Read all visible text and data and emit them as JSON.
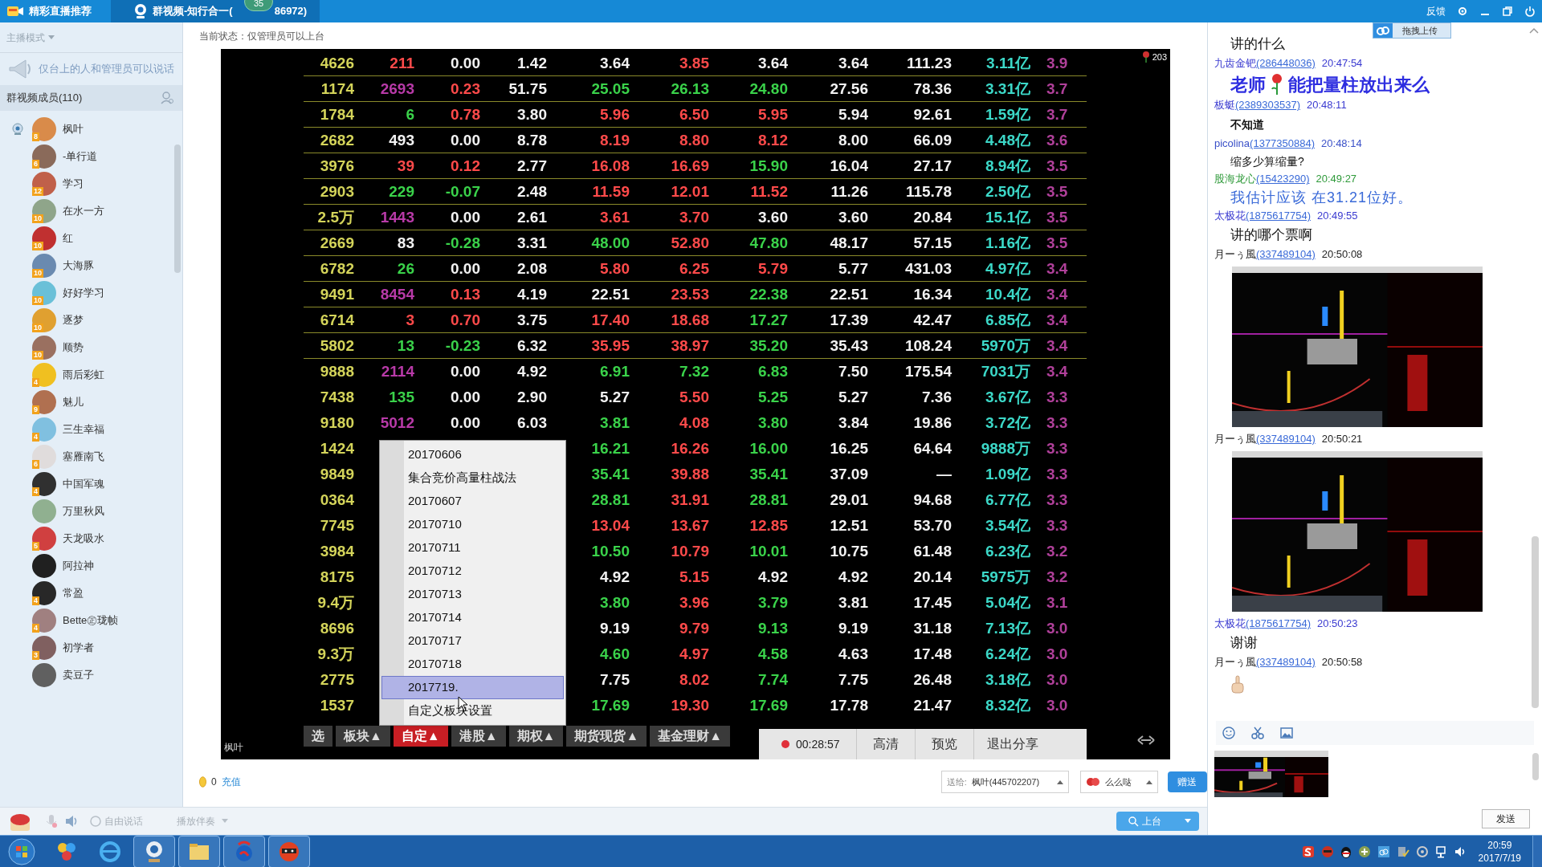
{
  "top_bar": {
    "tabs": [
      {
        "label": "精彩直播推荐",
        "selected": false
      },
      {
        "label": "群视频-知行合一(",
        "label_end": "86972)",
        "badge": "35",
        "selected": true
      }
    ],
    "feedback": "反馈"
  },
  "sidebar": {
    "mode": "主播模式",
    "notice": "仅台上的人和管理员可以说话",
    "members_title": "群视频成员(110)",
    "members": [
      {
        "name": "枫叶",
        "level": "8",
        "on_stage": true
      },
      {
        "name": "-单行道",
        "level": "6",
        "on_stage": false
      },
      {
        "name": "学习",
        "level": "12",
        "on_stage": false
      },
      {
        "name": "在水一方",
        "level": "10",
        "on_stage": false
      },
      {
        "name": "红",
        "level": "10",
        "on_stage": false
      },
      {
        "name": "大海豚",
        "level": "10",
        "on_stage": false
      },
      {
        "name": "好好学习",
        "level": "10",
        "on_stage": false
      },
      {
        "name": "逐梦",
        "level": "10",
        "on_stage": false
      },
      {
        "name": "顺势",
        "level": "10",
        "on_stage": false
      },
      {
        "name": "雨后彩虹",
        "level": "4",
        "on_stage": false
      },
      {
        "name": "魅儿",
        "level": "9",
        "on_stage": false
      },
      {
        "name": "三生幸福",
        "level": "4",
        "on_stage": false
      },
      {
        "name": "塞雁南飞",
        "level": "6",
        "on_stage": false
      },
      {
        "name": "中国军魂",
        "level": "4",
        "on_stage": false
      },
      {
        "name": "万里秋风",
        "on_stage": false
      },
      {
        "name": "天龙吸水",
        "level": "5",
        "on_stage": false
      },
      {
        "name": "阿拉神",
        "on_stage": false
      },
      {
        "name": "常盈",
        "level": "4",
        "on_stage": false
      },
      {
        "name": "Bette㊣珑帧",
        "level": "4",
        "on_stage": false
      },
      {
        "name": "初学者",
        "level": "3",
        "on_stage": false
      },
      {
        "name": "卖豆子",
        "on_stage": false
      }
    ]
  },
  "center": {
    "status": "当前状态：仅管理员可以上台",
    "video": {
      "presenter": "枫叶",
      "viewers": "203",
      "table": {
        "rows": [
          {
            "ruled": true,
            "cells": [
              {
                "text": "4626",
                "color": "#d4d45a"
              },
              {
                "text": "211",
                "color": "#ff4a4a"
              },
              {
                "text": "0.00",
                "color": "#f2f2f2"
              },
              {
                "text": "1.42",
                "color": "#f2f2f2"
              },
              {
                "text": "3.64",
                "color": "#f2f2f2"
              },
              {
                "text": "3.85",
                "color": "#ff4a4a"
              },
              {
                "text": "3.64",
                "color": "#f2f2f2"
              },
              {
                "text": "3.64",
                "color": "#f2f2f2"
              },
              {
                "text": "111.23",
                "color": "#f2f2f2"
              },
              {
                "text": "3.11亿",
                "color": "#3cd8c8"
              },
              {
                "text": "3.9",
                "color": "#b0409a"
              }
            ]
          },
          {
            "ruled": true,
            "cells": [
              {
                "text": "1174",
                "color": "#d4d45a"
              },
              {
                "text": "2693",
                "color": "#b83aa8"
              },
              {
                "text": "0.23",
                "color": "#ff4a4a"
              },
              {
                "text": "51.75",
                "color": "#f2f2f2"
              },
              {
                "text": "25.05",
                "color": "#3ad24a"
              },
              {
                "text": "26.13",
                "color": "#3ad24a"
              },
              {
                "text": "24.80",
                "color": "#3ad24a"
              },
              {
                "text": "27.56",
                "color": "#f2f2f2"
              },
              {
                "text": "78.36",
                "color": "#f2f2f2"
              },
              {
                "text": "3.31亿",
                "color": "#3cd8c8"
              },
              {
                "text": "3.7",
                "color": "#b0409a"
              }
            ]
          },
          {
            "ruled": true,
            "cells": [
              {
                "text": "1784",
                "color": "#d4d45a"
              },
              {
                "text": "6",
                "color": "#3ad24a"
              },
              {
                "text": "0.78",
                "color": "#ff4a4a"
              },
              {
                "text": "3.80",
                "color": "#f2f2f2"
              },
              {
                "text": "5.96",
                "color": "#ff4a4a"
              },
              {
                "text": "6.50",
                "color": "#ff4a4a"
              },
              {
                "text": "5.95",
                "color": "#ff4a4a"
              },
              {
                "text": "5.94",
                "color": "#f2f2f2"
              },
              {
                "text": "92.61",
                "color": "#f2f2f2"
              },
              {
                "text": "1.59亿",
                "color": "#3cd8c8"
              },
              {
                "text": "3.7",
                "color": "#b0409a"
              }
            ]
          },
          {
            "ruled": true,
            "cells": [
              {
                "text": "2682",
                "color": "#d4d45a"
              },
              {
                "text": "493",
                "color": "#f2f2f2"
              },
              {
                "text": "0.00",
                "color": "#f2f2f2"
              },
              {
                "text": "8.78",
                "color": "#f2f2f2"
              },
              {
                "text": "8.19",
                "color": "#ff4a4a"
              },
              {
                "text": "8.80",
                "color": "#ff4a4a"
              },
              {
                "text": "8.12",
                "color": "#ff4a4a"
              },
              {
                "text": "8.00",
                "color": "#f2f2f2"
              },
              {
                "text": "66.09",
                "color": "#f2f2f2"
              },
              {
                "text": "4.48亿",
                "color": "#3cd8c8"
              },
              {
                "text": "3.6",
                "color": "#b0409a"
              }
            ]
          },
          {
            "ruled": true,
            "cells": [
              {
                "text": "3976",
                "color": "#d4d45a"
              },
              {
                "text": "39",
                "color": "#ff4a4a"
              },
              {
                "text": "0.12",
                "color": "#ff4a4a"
              },
              {
                "text": "2.77",
                "color": "#f2f2f2"
              },
              {
                "text": "16.08",
                "color": "#ff4a4a"
              },
              {
                "text": "16.69",
                "color": "#ff4a4a"
              },
              {
                "text": "15.90",
                "color": "#3ad24a"
              },
              {
                "text": "16.04",
                "color": "#f2f2f2"
              },
              {
                "text": "27.17",
                "color": "#f2f2f2"
              },
              {
                "text": "8.94亿",
                "color": "#3cd8c8"
              },
              {
                "text": "3.5",
                "color": "#b0409a"
              }
            ]
          },
          {
            "ruled": true,
            "cells": [
              {
                "text": "2903",
                "color": "#d4d45a"
              },
              {
                "text": "229",
                "color": "#3ad24a"
              },
              {
                "text": "-0.07",
                "color": "#3ad24a"
              },
              {
                "text": "2.48",
                "color": "#f2f2f2"
              },
              {
                "text": "11.59",
                "color": "#ff4a4a"
              },
              {
                "text": "12.01",
                "color": "#ff4a4a"
              },
              {
                "text": "11.52",
                "color": "#ff4a4a"
              },
              {
                "text": "11.26",
                "color": "#f2f2f2"
              },
              {
                "text": "115.78",
                "color": "#f2f2f2"
              },
              {
                "text": "2.50亿",
                "color": "#3cd8c8"
              },
              {
                "text": "3.5",
                "color": "#b0409a"
              }
            ]
          },
          {
            "ruled": true,
            "cells": [
              {
                "text": "2.5万",
                "color": "#d4d45a"
              },
              {
                "text": "1443",
                "color": "#b83aa8"
              },
              {
                "text": "0.00",
                "color": "#f2f2f2"
              },
              {
                "text": "2.61",
                "color": "#f2f2f2"
              },
              {
                "text": "3.61",
                "color": "#ff4a4a"
              },
              {
                "text": "3.70",
                "color": "#ff4a4a"
              },
              {
                "text": "3.60",
                "color": "#f2f2f2"
              },
              {
                "text": "3.60",
                "color": "#f2f2f2"
              },
              {
                "text": "20.84",
                "color": "#f2f2f2"
              },
              {
                "text": "15.1亿",
                "color": "#3cd8c8"
              },
              {
                "text": "3.5",
                "color": "#b0409a"
              }
            ]
          },
          {
            "ruled": true,
            "cells": [
              {
                "text": "2669",
                "color": "#d4d45a"
              },
              {
                "text": "83",
                "color": "#f2f2f2"
              },
              {
                "text": "-0.28",
                "color": "#3ad24a"
              },
              {
                "text": "3.31",
                "color": "#f2f2f2"
              },
              {
                "text": "48.00",
                "color": "#3ad24a"
              },
              {
                "text": "52.80",
                "color": "#ff4a4a"
              },
              {
                "text": "47.80",
                "color": "#3ad24a"
              },
              {
                "text": "48.17",
                "color": "#f2f2f2"
              },
              {
                "text": "57.15",
                "color": "#f2f2f2"
              },
              {
                "text": "1.16亿",
                "color": "#3cd8c8"
              },
              {
                "text": "3.5",
                "color": "#b0409a"
              }
            ]
          },
          {
            "ruled": true,
            "cells": [
              {
                "text": "6782",
                "color": "#d4d45a"
              },
              {
                "text": "26",
                "color": "#3ad24a"
              },
              {
                "text": "0.00",
                "color": "#f2f2f2"
              },
              {
                "text": "2.08",
                "color": "#f2f2f2"
              },
              {
                "text": "5.80",
                "color": "#ff4a4a"
              },
              {
                "text": "6.25",
                "color": "#ff4a4a"
              },
              {
                "text": "5.79",
                "color": "#ff4a4a"
              },
              {
                "text": "5.77",
                "color": "#f2f2f2"
              },
              {
                "text": "431.03",
                "color": "#f2f2f2"
              },
              {
                "text": "4.97亿",
                "color": "#3cd8c8"
              },
              {
                "text": "3.4",
                "color": "#b0409a"
              }
            ]
          },
          {
            "ruled": true,
            "cells": [
              {
                "text": "9491",
                "color": "#d4d45a"
              },
              {
                "text": "8454",
                "color": "#b83aa8"
              },
              {
                "text": "0.13",
                "color": "#ff4a4a"
              },
              {
                "text": "4.19",
                "color": "#f2f2f2"
              },
              {
                "text": "22.51",
                "color": "#f2f2f2"
              },
              {
                "text": "23.53",
                "color": "#ff4a4a"
              },
              {
                "text": "22.38",
                "color": "#3ad24a"
              },
              {
                "text": "22.51",
                "color": "#f2f2f2"
              },
              {
                "text": "16.34",
                "color": "#f2f2f2"
              },
              {
                "text": "10.4亿",
                "color": "#3cd8c8"
              },
              {
                "text": "3.4",
                "color": "#b0409a"
              }
            ]
          },
          {
            "ruled": true,
            "cells": [
              {
                "text": "6714",
                "color": "#d4d45a"
              },
              {
                "text": "3",
                "color": "#ff4a4a"
              },
              {
                "text": "0.70",
                "color": "#ff4a4a"
              },
              {
                "text": "3.75",
                "color": "#f2f2f2"
              },
              {
                "text": "17.40",
                "color": "#ff4a4a"
              },
              {
                "text": "18.68",
                "color": "#ff4a4a"
              },
              {
                "text": "17.27",
                "color": "#3ad24a"
              },
              {
                "text": "17.39",
                "color": "#f2f2f2"
              },
              {
                "text": "42.47",
                "color": "#f2f2f2"
              },
              {
                "text": "6.85亿",
                "color": "#3cd8c8"
              },
              {
                "text": "3.4",
                "color": "#b0409a"
              }
            ]
          },
          {
            "ruled": true,
            "cells": [
              {
                "text": "5802",
                "color": "#d4d45a"
              },
              {
                "text": "13",
                "color": "#3ad24a"
              },
              {
                "text": "-0.23",
                "color": "#3ad24a"
              },
              {
                "text": "6.32",
                "color": "#f2f2f2"
              },
              {
                "text": "35.95",
                "color": "#ff4a4a"
              },
              {
                "text": "38.97",
                "color": "#ff4a4a"
              },
              {
                "text": "35.20",
                "color": "#3ad24a"
              },
              {
                "text": "35.43",
                "color": "#f2f2f2"
              },
              {
                "text": "108.24",
                "color": "#f2f2f2"
              },
              {
                "text": "5970万",
                "color": "#3cd8c8"
              },
              {
                "text": "3.4",
                "color": "#b0409a"
              }
            ]
          },
          {
            "ruled": false,
            "cells": [
              {
                "text": "9888",
                "color": "#d4d45a"
              },
              {
                "text": "2114",
                "color": "#b83aa8"
              },
              {
                "text": "0.00",
                "color": "#f2f2f2"
              },
              {
                "text": "4.92",
                "color": "#f2f2f2"
              },
              {
                "text": "6.91",
                "color": "#3ad24a"
              },
              {
                "text": "7.32",
                "color": "#3ad24a"
              },
              {
                "text": "6.83",
                "color": "#3ad24a"
              },
              {
                "text": "7.50",
                "color": "#f2f2f2"
              },
              {
                "text": "175.54",
                "color": "#f2f2f2"
              },
              {
                "text": "7031万",
                "color": "#3cd8c8"
              },
              {
                "text": "3.4",
                "color": "#b0409a"
              }
            ]
          },
          {
            "ruled": false,
            "cells": [
              {
                "text": "7438",
                "color": "#d4d45a"
              },
              {
                "text": "135",
                "color": "#3ad24a"
              },
              {
                "text": "0.00",
                "color": "#f2f2f2"
              },
              {
                "text": "2.90",
                "color": "#f2f2f2"
              },
              {
                "text": "5.27",
                "color": "#f2f2f2"
              },
              {
                "text": "5.50",
                "color": "#ff4a4a"
              },
              {
                "text": "5.25",
                "color": "#3ad24a"
              },
              {
                "text": "5.27",
                "color": "#f2f2f2"
              },
              {
                "text": "7.36",
                "color": "#f2f2f2"
              },
              {
                "text": "3.67亿",
                "color": "#3cd8c8"
              },
              {
                "text": "3.3",
                "color": "#b0409a"
              }
            ]
          },
          {
            "ruled": false,
            "cells": [
              {
                "text": "9180",
                "color": "#d4d45a"
              },
              {
                "text": "5012",
                "color": "#b83aa8"
              },
              {
                "text": "0.00",
                "color": "#f2f2f2"
              },
              {
                "text": "6.03",
                "color": "#f2f2f2"
              },
              {
                "text": "3.81",
                "color": "#3ad24a"
              },
              {
                "text": "4.08",
                "color": "#ff4a4a"
              },
              {
                "text": "3.80",
                "color": "#3ad24a"
              },
              {
                "text": "3.84",
                "color": "#f2f2f2"
              },
              {
                "text": "19.86",
                "color": "#f2f2f2"
              },
              {
                "text": "3.72亿",
                "color": "#3cd8c8"
              },
              {
                "text": "3.3",
                "color": "#b0409a"
              }
            ]
          },
          {
            "ruled": false,
            "cells": [
              {
                "text": "1424",
                "color": "#d4d45a"
              },
              {
                "text": "16.21",
                "color": "#3ad24a"
              },
              {
                "text": "16.26",
                "color": "#ff4a4a"
              },
              {
                "text": "16.00",
                "color": "#3ad24a"
              },
              {
                "text": "16.25",
                "color": "#f2f2f2"
              },
              {
                "text": "64.64",
                "color": "#f2f2f2"
              },
              {
                "text": "9888万",
                "color": "#3cd8c8"
              },
              {
                "text": "3.3",
                "color": "#b0409a"
              }
            ]
          },
          {
            "ruled": false,
            "cells": [
              {
                "text": "9849",
                "color": "#d4d45a"
              },
              {
                "text": "35.41",
                "color": "#3ad24a"
              },
              {
                "text": "39.88",
                "color": "#ff4a4a"
              },
              {
                "text": "35.41",
                "color": "#3ad24a"
              },
              {
                "text": "37.09",
                "color": "#f2f2f2"
              },
              {
                "text": "—",
                "color": "#f2f2f2"
              },
              {
                "text": "1.09亿",
                "color": "#3cd8c8"
              },
              {
                "text": "3.3",
                "color": "#b0409a"
              }
            ]
          },
          {
            "ruled": false,
            "cells": [
              {
                "text": "0364",
                "color": "#d4d45a"
              },
              {
                "text": "28.81",
                "color": "#3ad24a"
              },
              {
                "text": "31.91",
                "color": "#ff4a4a"
              },
              {
                "text": "28.81",
                "color": "#3ad24a"
              },
              {
                "text": "29.01",
                "color": "#f2f2f2"
              },
              {
                "text": "94.68",
                "color": "#f2f2f2"
              },
              {
                "text": "6.77亿",
                "color": "#3cd8c8"
              },
              {
                "text": "3.3",
                "color": "#b0409a"
              }
            ]
          },
          {
            "ruled": false,
            "cells": [
              {
                "text": "7745",
                "color": "#d4d45a"
              },
              {
                "text": "13.04",
                "color": "#ff4a4a"
              },
              {
                "text": "13.67",
                "color": "#ff4a4a"
              },
              {
                "text": "12.85",
                "color": "#ff4a4a"
              },
              {
                "text": "12.51",
                "color": "#f2f2f2"
              },
              {
                "text": "53.70",
                "color": "#f2f2f2"
              },
              {
                "text": "3.54亿",
                "color": "#3cd8c8"
              },
              {
                "text": "3.3",
                "color": "#b0409a"
              }
            ]
          },
          {
            "ruled": false,
            "cells": [
              {
                "text": "3984",
                "color": "#d4d45a"
              },
              {
                "text": "10.50",
                "color": "#3ad24a"
              },
              {
                "text": "10.79",
                "color": "#ff4a4a"
              },
              {
                "text": "10.01",
                "color": "#3ad24a"
              },
              {
                "text": "10.75",
                "color": "#f2f2f2"
              },
              {
                "text": "61.48",
                "color": "#f2f2f2"
              },
              {
                "text": "6.23亿",
                "color": "#3cd8c8"
              },
              {
                "text": "3.2",
                "color": "#b0409a"
              }
            ]
          },
          {
            "ruled": false,
            "cells": [
              {
                "text": "8175",
                "color": "#d4d45a"
              },
              {
                "text": "4.92",
                "color": "#f2f2f2"
              },
              {
                "text": "5.15",
                "color": "#ff4a4a"
              },
              {
                "text": "4.92",
                "color": "#f2f2f2"
              },
              {
                "text": "4.92",
                "color": "#f2f2f2"
              },
              {
                "text": "20.14",
                "color": "#f2f2f2"
              },
              {
                "text": "5975万",
                "color": "#3cd8c8"
              },
              {
                "text": "3.2",
                "color": "#b0409a"
              }
            ]
          },
          {
            "ruled": false,
            "cells": [
              {
                "text": "9.4万",
                "color": "#d4d45a"
              },
              {
                "text": "3.80",
                "color": "#3ad24a"
              },
              {
                "text": "3.96",
                "color": "#ff4a4a"
              },
              {
                "text": "3.79",
                "color": "#3ad24a"
              },
              {
                "text": "3.81",
                "color": "#f2f2f2"
              },
              {
                "text": "17.45",
                "color": "#f2f2f2"
              },
              {
                "text": "5.04亿",
                "color": "#3cd8c8"
              },
              {
                "text": "3.1",
                "color": "#b0409a"
              }
            ]
          },
          {
            "ruled": false,
            "cells": [
              {
                "text": "8696",
                "color": "#d4d45a"
              },
              {
                "text": "9.19",
                "color": "#f2f2f2"
              },
              {
                "text": "9.79",
                "color": "#ff4a4a"
              },
              {
                "text": "9.13",
                "color": "#3ad24a"
              },
              {
                "text": "9.19",
                "color": "#f2f2f2"
              },
              {
                "text": "31.18",
                "color": "#f2f2f2"
              },
              {
                "text": "7.13亿",
                "color": "#3cd8c8"
              },
              {
                "text": "3.0",
                "color": "#b0409a"
              }
            ]
          },
          {
            "ruled": false,
            "cells": [
              {
                "text": "9.3万",
                "color": "#d4d45a"
              },
              {
                "text": "4.60",
                "color": "#3ad24a"
              },
              {
                "text": "4.97",
                "color": "#ff4a4a"
              },
              {
                "text": "4.58",
                "color": "#3ad24a"
              },
              {
                "text": "4.63",
                "color": "#f2f2f2"
              },
              {
                "text": "17.48",
                "color": "#f2f2f2"
              },
              {
                "text": "6.24亿",
                "color": "#3cd8c8"
              },
              {
                "text": "3.0",
                "color": "#b0409a"
              }
            ]
          },
          {
            "ruled": false,
            "cells": [
              {
                "text": "2775",
                "color": "#d4d45a"
              },
              {
                "text": "7.75",
                "color": "#f2f2f2"
              },
              {
                "text": "8.02",
                "color": "#ff4a4a"
              },
              {
                "text": "7.74",
                "color": "#3ad24a"
              },
              {
                "text": "7.75",
                "color": "#f2f2f2"
              },
              {
                "text": "26.48",
                "color": "#f2f2f2"
              },
              {
                "text": "3.18亿",
                "color": "#3cd8c8"
              },
              {
                "text": "3.0",
                "color": "#b0409a"
              }
            ]
          },
          {
            "ruled": false,
            "cells": [
              {
                "text": "1537",
                "color": "#d4d45a"
              },
              {
                "text": "17.69",
                "color": "#3ad24a"
              },
              {
                "text": "19.30",
                "color": "#ff4a4a"
              },
              {
                "text": "17.69",
                "color": "#3ad24a"
              },
              {
                "text": "17.78",
                "color": "#f2f2f2"
              },
              {
                "text": "21.47",
                "color": "#f2f2f2"
              },
              {
                "text": "8.32亿",
                "color": "#3cd8c8"
              },
              {
                "text": "3.0",
                "color": "#b0409a"
              }
            ]
          }
        ]
      },
      "menu": {
        "items": [
          {
            "label": "20170606",
            "selected": false
          },
          {
            "label": "集合竞价高量柱战法",
            "selected": false
          },
          {
            "label": "20170607",
            "selected": false
          },
          {
            "label": "20170710",
            "selected": false
          },
          {
            "label": "20170711",
            "selected": false
          },
          {
            "label": "20170712",
            "selected": false
          },
          {
            "label": "20170713",
            "selected": false
          },
          {
            "label": "20170714",
            "selected": false
          },
          {
            "label": "20170717",
            "selected": false
          },
          {
            "label": "20170718",
            "selected": false
          },
          {
            "label": "2017719.",
            "selected": true
          },
          {
            "label": "自定义板块设置",
            "selected": false
          }
        ]
      },
      "board_tabs": [
        {
          "label": "选",
          "selected": false
        },
        {
          "label": "板块▲",
          "selected": false
        },
        {
          "label": "自定▲",
          "selected": true
        },
        {
          "label": "港股▲",
          "selected": false
        },
        {
          "label": "期权▲",
          "selected": false
        },
        {
          "label": "期货现货▲",
          "selected": false
        },
        {
          "label": "基金理财▲",
          "selected": false
        }
      ],
      "recording": {
        "time": "00:28:57",
        "buttons": [
          "高清",
          "预览",
          "退出分享"
        ]
      }
    },
    "gift": {
      "balance": "0",
      "recharge": "充值",
      "to_label": "送给:",
      "recipient": "枫叶(445702207)",
      "gift": "么么哒",
      "send": "赠送"
    }
  },
  "toolbar": {
    "free_talk": "自由说话",
    "accompaniment": "播放伴奏",
    "stage": "上台"
  },
  "chat": {
    "upload": "拖拽上传",
    "messages": [
      {
        "kind": "text",
        "text": "讲的什么"
      },
      {
        "kind": "header",
        "name": "九齿金钯",
        "id": "(286448036)",
        "time": "20:47:54",
        "color": "#3a3ad0"
      },
      {
        "kind": "rose_text",
        "parts": [
          "老师",
          "能把量柱放出来么"
        ]
      },
      {
        "kind": "header",
        "name": "板蜓",
        "id": "(2389303537)",
        "time": "20:48:11",
        "color": "#3a3ad0"
      },
      {
        "kind": "bold_text",
        "text": "不知道"
      },
      {
        "kind": "header",
        "name": "picolina",
        "id": "(1377350884)",
        "time": "20:48:14",
        "color": "#3a50c8"
      },
      {
        "kind": "small_text",
        "text": "缩多少算缩量?"
      },
      {
        "kind": "header",
        "name": "股海龙心",
        "id": "(15423290)",
        "time": "20:49:27",
        "color": "#2f9a3a"
      },
      {
        "kind": "blue_text",
        "text": "我估计应该  在31.21位好。"
      },
      {
        "kind": "header",
        "name": "太极花",
        "id": "(1875617754)",
        "time": "20:49:55",
        "color": "#3a3ad0"
      },
      {
        "kind": "text",
        "text": "讲的哪个票啊"
      },
      {
        "kind": "header",
        "name": "月ーぅ風",
        "id": "(337489104)",
        "time": "20:50:08"
      },
      {
        "kind": "picture"
      },
      {
        "kind": "header",
        "name": "月ーぅ風",
        "id": "(337489104)",
        "time": "20:50:21"
      },
      {
        "kind": "picture"
      },
      {
        "kind": "header",
        "name": "太极花",
        "id": "(1875617754)",
        "time": "20:50:23",
        "color": "#3a3ad0"
      },
      {
        "kind": "text",
        "text": "谢谢"
      },
      {
        "kind": "header",
        "name": "月ーぅ風",
        "id": "(337489104)",
        "time": "20:50:58"
      },
      {
        "kind": "emoji"
      }
    ],
    "send": "发送"
  },
  "taskbar": {
    "time": "20:59",
    "date": "2017/7/19"
  }
}
